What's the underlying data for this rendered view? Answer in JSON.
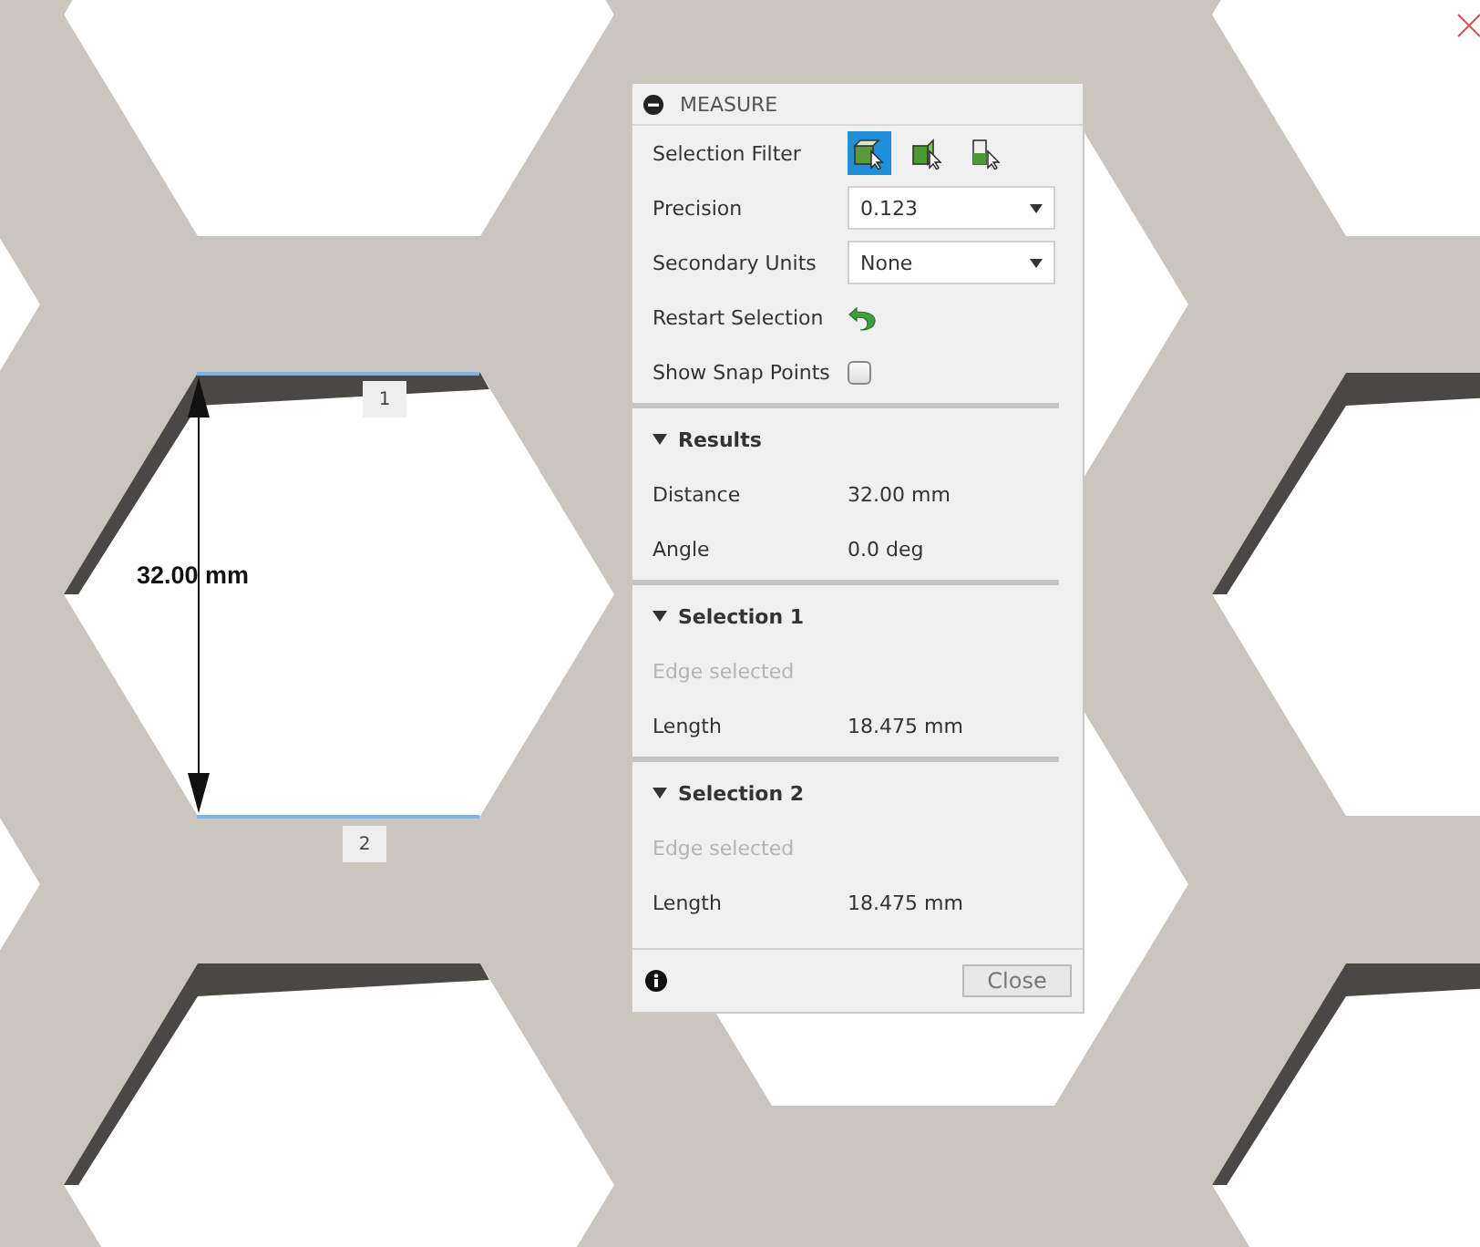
{
  "viewport": {
    "dimension": "32.00 mm",
    "edge_tags": [
      "1",
      "2"
    ]
  },
  "dialog": {
    "title": "MEASURE",
    "filter": {
      "label": "Selection Filter",
      "options": [
        {
          "selected": true
        },
        {
          "selected": false
        },
        {
          "selected": false
        }
      ]
    },
    "precision": {
      "label": "Precision",
      "value": "0.123"
    },
    "secondary_units": {
      "label": "Secondary Units",
      "value": "None"
    },
    "restart": {
      "label": "Restart Selection"
    },
    "snap_points": {
      "label": "Show Snap Points",
      "checked": false
    },
    "sections": [
      {
        "title": "Results",
        "expanded": true,
        "rows": [
          {
            "label": "Distance",
            "value": "32.00 mm"
          },
          {
            "label": "Angle",
            "value": "0.0 deg"
          }
        ]
      },
      {
        "title": "Selection 1",
        "expanded": true,
        "note": "Edge selected",
        "rows": [
          {
            "label": "Length",
            "value": "18.475 mm"
          }
        ]
      },
      {
        "title": "Selection 2",
        "expanded": true,
        "note": "Edge selected",
        "rows": [
          {
            "label": "Length",
            "value": "18.475 mm"
          }
        ]
      }
    ],
    "close": "Close"
  }
}
